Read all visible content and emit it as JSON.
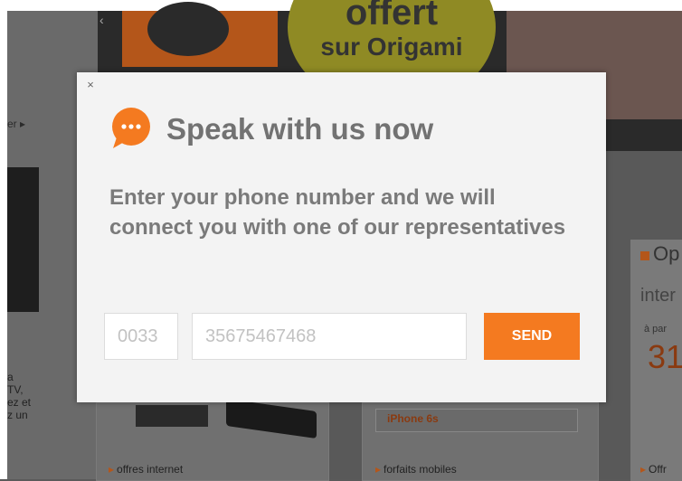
{
  "background": {
    "banner_line1": "offert",
    "banner_line2": "sur Origami",
    "left_label": "er",
    "left_text": "a\nTV,\nez et\nz un",
    "far_card_label": "Op",
    "far_card_inter": "inter",
    "far_card_apart": "à par",
    "far_card_price": "31",
    "iphone_label": "iPhone 6s",
    "links": [
      "offres internet",
      "forfaits mobiles",
      "Offr"
    ]
  },
  "modal": {
    "close_label": "×",
    "title": "Speak with us now",
    "description": "Enter your phone number and we will connect you with one of our representatives",
    "country_code": {
      "value": "",
      "placeholder": "0033"
    },
    "phone": {
      "value": "",
      "placeholder": "35675467468"
    },
    "send_label": "SEND"
  },
  "colors": {
    "accent": "#f47a20",
    "title_text": "#727272",
    "modal_bg": "#f3f3f3"
  },
  "icons": [
    "close-icon",
    "chat-bubble-icon"
  ]
}
